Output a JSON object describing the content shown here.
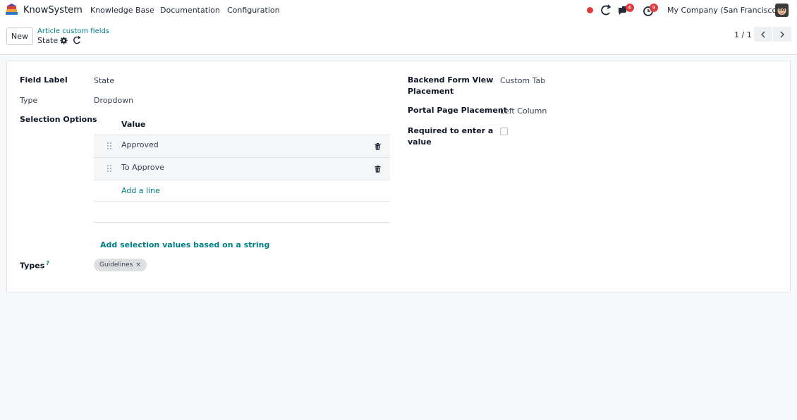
{
  "navbar": {
    "app_name": "KnowSystem",
    "menu": [
      "Knowledge Base",
      "Documentation",
      "Configuration"
    ],
    "messages_badge": "6",
    "activities_badge": "9",
    "company": "My Company (San Francisco)"
  },
  "control_panel": {
    "new_label": "New",
    "breadcrumb": "Article custom fields",
    "record_name": "State",
    "pager": "1 / 1"
  },
  "form": {
    "field_label": {
      "label": "Field Label",
      "value": "State"
    },
    "type": {
      "label": "Type",
      "value": "Dropdown"
    },
    "selection_options": {
      "label": "Selection Options",
      "column_header": "Value",
      "rows": [
        "Approved",
        "To Approve"
      ],
      "add_line": "Add a line"
    },
    "add_selection_link": "Add selection values based on a string",
    "types": {
      "label": "Types",
      "help": "?",
      "tags": [
        "Guidelines"
      ]
    },
    "backend_placement": {
      "label_line1": "Backend Form View",
      "label_line2": "Placement",
      "value": "Custom Tab"
    },
    "portal_placement": {
      "label": "Portal Page Placement",
      "value": "Left Column"
    },
    "required": {
      "label_line1": "Required to enter a",
      "label_line2": "value",
      "checked": false
    }
  },
  "colors": {
    "accent": "#017e84",
    "badge": "#e03e3e"
  }
}
